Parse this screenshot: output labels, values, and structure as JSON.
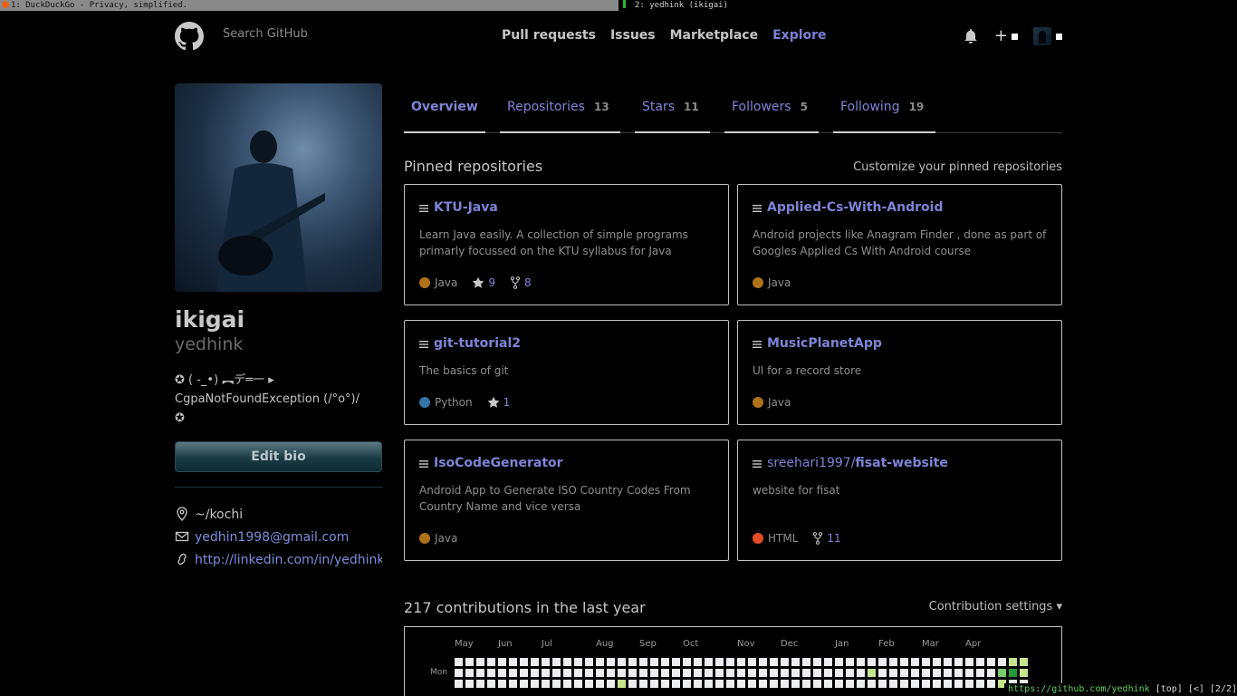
{
  "wm": {
    "left_title": "1: DuckDuckGo - Privacy, simplified.",
    "right_title": "2: yedhink (ikigai)"
  },
  "header": {
    "search_placeholder": "Search GitHub",
    "nav": [
      "Pull requests",
      "Issues",
      "Marketplace",
      "Explore"
    ],
    "plus": "+"
  },
  "profile": {
    "name": "ikigai",
    "login": "yedhink",
    "bio_lines": [
      "✪ (  -_•) ︻デ═一 ▸",
      "CgpaNotFoundException (/°o°)/",
      "✪"
    ],
    "edit_bio": "Edit bio",
    "location": "~/kochi",
    "email": "yedhin1998@gmail.com",
    "website": "http://linkedin.com/in/yedhink"
  },
  "tabs": [
    {
      "label": "Overview",
      "count": ""
    },
    {
      "label": "Repositories",
      "count": "13"
    },
    {
      "label": "Stars",
      "count": "11"
    },
    {
      "label": "Followers",
      "count": "5"
    },
    {
      "label": "Following",
      "count": "19"
    }
  ],
  "pinned": {
    "title": "Pinned repositories",
    "customize": "Customize your pinned repositories",
    "repos": [
      {
        "owner": "",
        "name": "KTU-Java",
        "desc": "Learn Java easily. A collection of simple programs primarly focussed on the KTU syllabus for Java",
        "lang": "Java",
        "lang_color": "#b07219",
        "stars": "9",
        "forks": "8"
      },
      {
        "owner": "",
        "name": "Applied-Cs-With-Android",
        "desc": "Android projects like Anagram Finder , done as part of Googles Applied Cs With Android course",
        "lang": "Java",
        "lang_color": "#b07219",
        "stars": "",
        "forks": ""
      },
      {
        "owner": "",
        "name": "git-tutorial2",
        "desc": "The basics of git",
        "lang": "Python",
        "lang_color": "#3572A5",
        "stars": "1",
        "forks": ""
      },
      {
        "owner": "",
        "name": "MusicPlanetApp",
        "desc": "UI for a record store",
        "lang": "Java",
        "lang_color": "#b07219",
        "stars": "",
        "forks": ""
      },
      {
        "owner": "",
        "name": "IsoCodeGenerator",
        "desc": "Android App to Generate ISO Country Codes From Country Name and vice versa",
        "lang": "Java",
        "lang_color": "#b07219",
        "stars": "",
        "forks": ""
      },
      {
        "owner": "sreehari1997/",
        "name": "fisat-website",
        "desc": "website for fisat",
        "lang": "HTML",
        "lang_color": "#e34c26",
        "stars": "",
        "forks": "11"
      }
    ]
  },
  "contributions": {
    "title": "217 contributions in the last year",
    "settings": "Contribution settings ▾",
    "months": [
      "May",
      "Jun",
      "Jul",
      "Aug",
      "Sep",
      "Oct",
      "Nov",
      "Dec",
      "Jan",
      "Feb",
      "Mar",
      "Apr"
    ],
    "day_label": "Mon"
  },
  "statusbar": {
    "url": "https://github.com/yedhink",
    "info": " [top] [<] [2/2]"
  }
}
